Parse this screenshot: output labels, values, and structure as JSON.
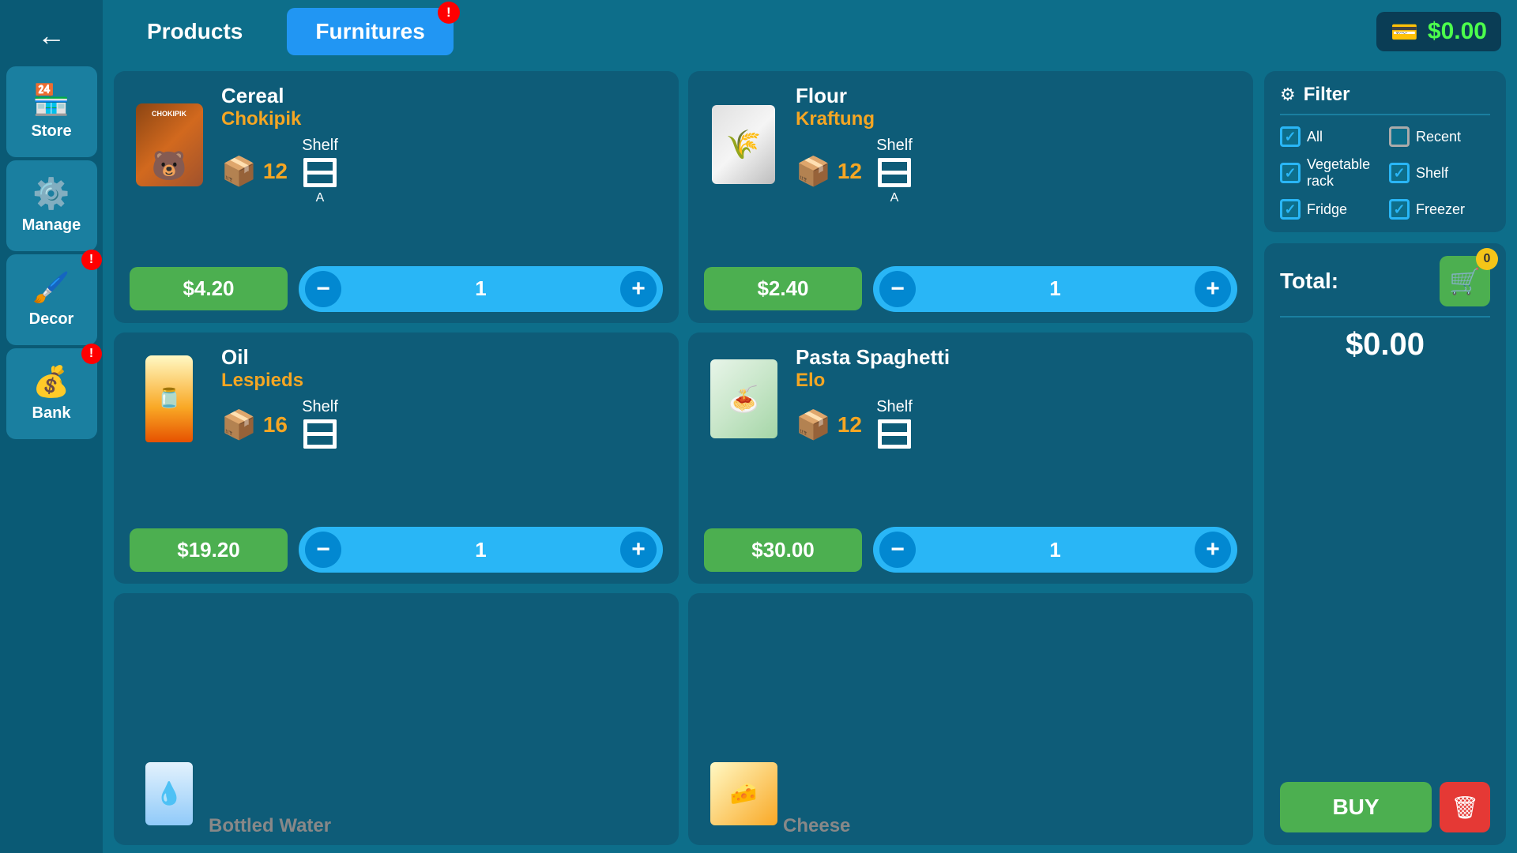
{
  "sidebar": {
    "back_label": "←",
    "items": [
      {
        "id": "store",
        "label": "Store",
        "icon": "🏪",
        "badge": null,
        "active": true
      },
      {
        "id": "manage",
        "label": "Manage",
        "icon": "⚙️",
        "badge": null
      },
      {
        "id": "decor",
        "label": "Decor",
        "icon": "🖌️",
        "badge": "!"
      },
      {
        "id": "bank",
        "label": "Bank",
        "icon": "💰",
        "badge": "!"
      }
    ]
  },
  "topbar": {
    "tabs": [
      {
        "id": "products",
        "label": "Products",
        "active": false,
        "badge": null
      },
      {
        "id": "furnitures",
        "label": "Furnitures",
        "active": true,
        "badge": "!"
      }
    ],
    "money": "$0.00"
  },
  "products": [
    {
      "id": "cereal",
      "name": "Cereal",
      "brand": "Chokipik",
      "qty": "12",
      "shelf": "Shelf",
      "shelf_sub": "A",
      "price": "$4.20",
      "count": "1"
    },
    {
      "id": "flour",
      "name": "Flour",
      "brand": "Kraftung",
      "qty": "12",
      "shelf": "Shelf",
      "shelf_sub": "A",
      "price": "$2.40",
      "count": "1"
    },
    {
      "id": "oil",
      "name": "Oil",
      "brand": "Lespieds",
      "qty": "16",
      "shelf": "Shelf",
      "shelf_sub": "",
      "price": "$19.20",
      "count": "1"
    },
    {
      "id": "pasta",
      "name": "Pasta Spaghetti",
      "brand": "Elo",
      "qty": "12",
      "shelf": "Shelf",
      "shelf_sub": "",
      "price": "$30.00",
      "count": "1"
    }
  ],
  "partial_products": [
    {
      "name": "Bottled Water"
    },
    {
      "name": "Cheese"
    }
  ],
  "filter": {
    "title": "Filter",
    "items": [
      {
        "id": "all",
        "label": "All",
        "checked": true
      },
      {
        "id": "recent",
        "label": "Recent",
        "checked": false
      },
      {
        "id": "vegrack",
        "label": "Vegetable rack",
        "checked": true
      },
      {
        "id": "shelf",
        "label": "Shelf",
        "checked": true
      },
      {
        "id": "fridge",
        "label": "Fridge",
        "checked": true
      },
      {
        "id": "freezer",
        "label": "Freezer",
        "checked": true
      }
    ]
  },
  "cart": {
    "total_label": "Total:",
    "total_amount": "$0.00",
    "badge": "0",
    "buy_label": "BUY"
  }
}
